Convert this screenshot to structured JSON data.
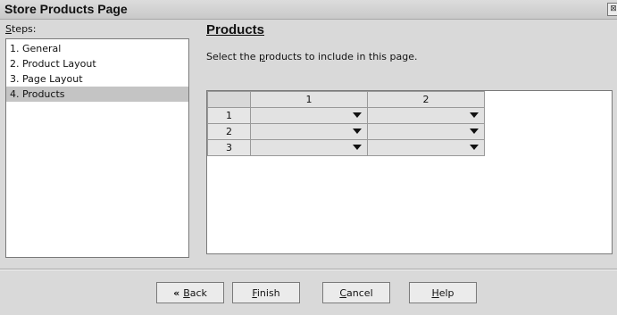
{
  "window": {
    "title": "Store Products Page",
    "close_glyph": "⊠"
  },
  "steps": {
    "label_prefix": "S",
    "label_rest": "teps:",
    "items": [
      "1. General",
      "2. Product Layout",
      "3. Page Layout",
      "4. Products"
    ],
    "selected_index": 3
  },
  "page": {
    "heading": "Products",
    "instruction_pre": "Select the ",
    "instruction_key": "p",
    "instruction_post": "roducts to include in this page."
  },
  "grid": {
    "columns": [
      "1",
      "2"
    ],
    "rows": [
      "1",
      "2",
      "3"
    ]
  },
  "buttons": {
    "back_chevrons": "«",
    "back_key": "B",
    "back_rest": "ack",
    "finish_key": "F",
    "finish_rest": "inish",
    "cancel_key": "C",
    "cancel_rest": "ancel",
    "help_key": "H",
    "help_rest": "elp"
  }
}
